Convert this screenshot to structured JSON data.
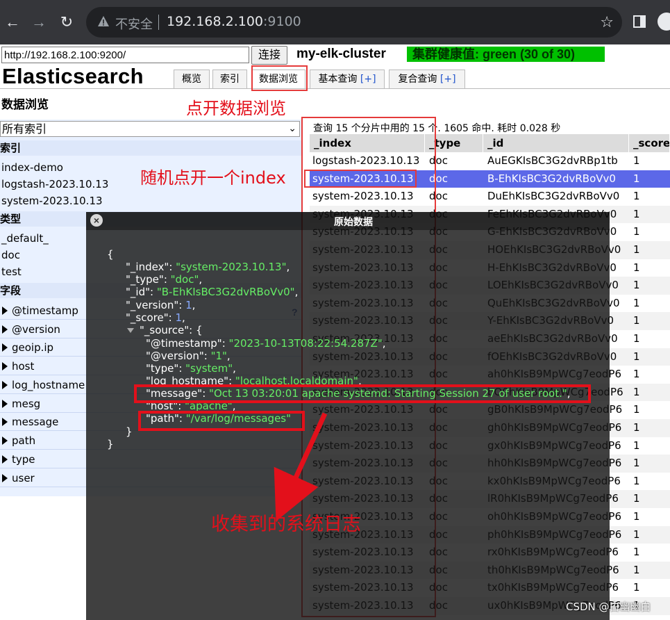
{
  "browser": {
    "security_label": "不安全",
    "url_host": "192.168.2.100",
    "url_port": ":9100"
  },
  "header": {
    "connection_url": "http://192.168.2.100:9200/",
    "connect_label": "连接",
    "cluster_name": "my-elk-cluster",
    "health": "集群健康值: green (30 of 30)",
    "app_title": "Elasticsearch",
    "tabs": [
      {
        "label": "概览"
      },
      {
        "label": "索引"
      },
      {
        "label": "数据浏览"
      },
      {
        "label": "基本查询",
        "plus": "[+]"
      },
      {
        "label": "复合查询",
        "plus": "[+]"
      }
    ]
  },
  "page": {
    "section_title": "数据浏览"
  },
  "filter": {
    "index_selected": "所有索引",
    "indices_heading": "索引",
    "indices": [
      "index-demo",
      "logstash-2023.10.13",
      "system-2023.10.13"
    ],
    "types_heading": "类型",
    "types": [
      "_default_",
      "doc",
      "test"
    ],
    "fields_heading": "字段",
    "fields": [
      "@timestamp",
      "@version",
      "geoip.ip",
      "host",
      "log_hostname",
      "mesg",
      "message",
      "path",
      "type",
      "user"
    ],
    "help": "?"
  },
  "results": {
    "summary": "查询 15 个分片中用的 15 个. 1605 命中. 耗时 0.028 秒",
    "columns": [
      "_index",
      "_type",
      "_id",
      "_score"
    ],
    "rows": [
      {
        "index": "logstash-2023.10.13",
        "type": "doc",
        "id": "AuEGKIsBC3G2dvRBp1tb",
        "score": "1"
      },
      {
        "index": "system-2023.10.13",
        "type": "doc",
        "id": "B-EhKIsBC3G2dvRBoVv0",
        "score": "1",
        "selected": true
      },
      {
        "index": "system-2023.10.13",
        "type": "doc",
        "id": "DuEhKIsBC3G2dvRBoVv0",
        "score": "1"
      },
      {
        "index": "system-2023.10.13",
        "type": "doc",
        "id": "FeEhKIsBC3G2dvRBoVv0",
        "score": "1"
      },
      {
        "index": "system-2023.10.13",
        "type": "doc",
        "id": "G-EhKIsBC3G2dvRBoVv0",
        "score": "1"
      },
      {
        "index": "system-2023.10.13",
        "type": "doc",
        "id": "HOEhKIsBC3G2dvRBoVv0",
        "score": "1"
      },
      {
        "index": "system-2023.10.13",
        "type": "doc",
        "id": "H-EhKIsBC3G2dvRBoVv0",
        "score": "1"
      },
      {
        "index": "system-2023.10.13",
        "type": "doc",
        "id": "LOEhKIsBC3G2dvRBoVv0",
        "score": "1"
      },
      {
        "index": "system-2023.10.13",
        "type": "doc",
        "id": "QuEhKIsBC3G2dvRBoVv0",
        "score": "1"
      },
      {
        "index": "system-2023.10.13",
        "type": "doc",
        "id": "Y-EhKIsBC3G2dvRBoVv0",
        "score": "1"
      },
      {
        "index": "system-2023.10.13",
        "type": "doc",
        "id": "aeEhKIsBC3G2dvRBoVv0",
        "score": "1"
      },
      {
        "index": "system-2023.10.13",
        "type": "doc",
        "id": "fOEhKIsBC3G2dvRBoVv0",
        "score": "1"
      },
      {
        "index": "system-2023.10.13",
        "type": "doc",
        "id": "ah0hKIsB9MpWCg7eodP6",
        "score": "1"
      },
      {
        "index": "system-2023.10.13",
        "type": "doc",
        "id": "bO0hKIsB9MpWCg7eodP6",
        "score": "1"
      },
      {
        "index": "system-2023.10.13",
        "type": "doc",
        "id": "gB0hKIsB9MpWCg7eodP6",
        "score": "1"
      },
      {
        "index": "system-2023.10.13",
        "type": "doc",
        "id": "gh0hKIsB9MpWCg7eodP6",
        "score": "1"
      },
      {
        "index": "system-2023.10.13",
        "type": "doc",
        "id": "gx0hKIsB9MpWCg7eodP6",
        "score": "1"
      },
      {
        "index": "system-2023.10.13",
        "type": "doc",
        "id": "hh0hKIsB9MpWCg7eodP6",
        "score": "1"
      },
      {
        "index": "system-2023.10.13",
        "type": "doc",
        "id": "kx0hKIsB9MpWCg7eodP6",
        "score": "1"
      },
      {
        "index": "system-2023.10.13",
        "type": "doc",
        "id": "lR0hKIsB9MpWCg7eodP6",
        "score": "1"
      },
      {
        "index": "system-2023.10.13",
        "type": "doc",
        "id": "oh0hKIsB9MpWCg7eodP6",
        "score": "1"
      },
      {
        "index": "system-2023.10.13",
        "type": "doc",
        "id": "ph0hKIsB9MpWCg7eodP6",
        "score": "1"
      },
      {
        "index": "system-2023.10.13",
        "type": "doc",
        "id": "rx0hKIsB9MpWCg7eodP6",
        "score": "1"
      },
      {
        "index": "system-2023.10.13",
        "type": "doc",
        "id": "th0hKIsB9MpWCg7eodP6",
        "score": "1"
      },
      {
        "index": "system-2023.10.13",
        "type": "doc",
        "id": "tx0hKIsB9MpWCg7eodP6",
        "score": "1"
      },
      {
        "index": "system-2023.10.13",
        "type": "doc",
        "id": "ux0hKIsB9MpWCg7eodP6",
        "score": "1"
      }
    ]
  },
  "dialog": {
    "title": "原始数据",
    "lines": [
      {
        "indent": 0,
        "text": "{"
      },
      {
        "indent": 1,
        "key": "\"_index\"",
        "value": "\"system-2023.10.13\"",
        "vtype": "str",
        "suffix": ","
      },
      {
        "indent": 1,
        "key": "\"_type\"",
        "value": "\"doc\"",
        "vtype": "str",
        "suffix": ","
      },
      {
        "indent": 1,
        "key": "\"_id\"",
        "value": "\"B-EhKIsBC3G2dvRBoVv0\"",
        "vtype": "str",
        "suffix": ","
      },
      {
        "indent": 1,
        "key": "\"_version\"",
        "value": "1",
        "vtype": "num",
        "suffix": ","
      },
      {
        "indent": 1,
        "key": "\"_score\"",
        "value": "1",
        "vtype": "num",
        "suffix": ","
      },
      {
        "indent": 1,
        "key": "\"_source\"",
        "value": "",
        "vtype": "obj",
        "suffix": "{",
        "toggle": true
      },
      {
        "indent": 2,
        "key": "\"@timestamp\"",
        "value": "\"2023-10-13T08:22:54.287Z\"",
        "vtype": "str",
        "suffix": ","
      },
      {
        "indent": 2,
        "key": "\"@version\"",
        "value": "\"1\"",
        "vtype": "str",
        "suffix": ","
      },
      {
        "indent": 2,
        "key": "\"type\"",
        "value": "\"system\"",
        "vtype": "str",
        "suffix": ","
      },
      {
        "indent": 2,
        "key": "\"log_hostname\"",
        "value": "\"localhost.localdomain\"",
        "vtype": "str",
        "suffix": ","
      },
      {
        "indent": 2,
        "key": "\"message\"",
        "value": "\"Oct 13 03:20:01 apache systemd: Starting Session 27 of user root.\"",
        "vtype": "str",
        "suffix": ","
      },
      {
        "indent": 2,
        "key": "\"host\"",
        "value": "\"apache\"",
        "vtype": "str",
        "suffix": ","
      },
      {
        "indent": 2,
        "key": "\"path\"",
        "value": "\"/var/log/messages\"",
        "vtype": "str",
        "suffix": ""
      },
      {
        "indent": 1,
        "text": "}"
      },
      {
        "indent": 0,
        "text": "}"
      }
    ]
  },
  "annotations": {
    "open_browse": "点开数据浏览",
    "open_index": "随机点开一个index",
    "collected": "收集到的系统日志"
  },
  "watermark": "CSDN @白幽幽白",
  "colors": {
    "health_green": "#00c000",
    "selected_row": "#5c68e8",
    "annotation_red": "#e3101b",
    "json_string": "#66ee66"
  }
}
